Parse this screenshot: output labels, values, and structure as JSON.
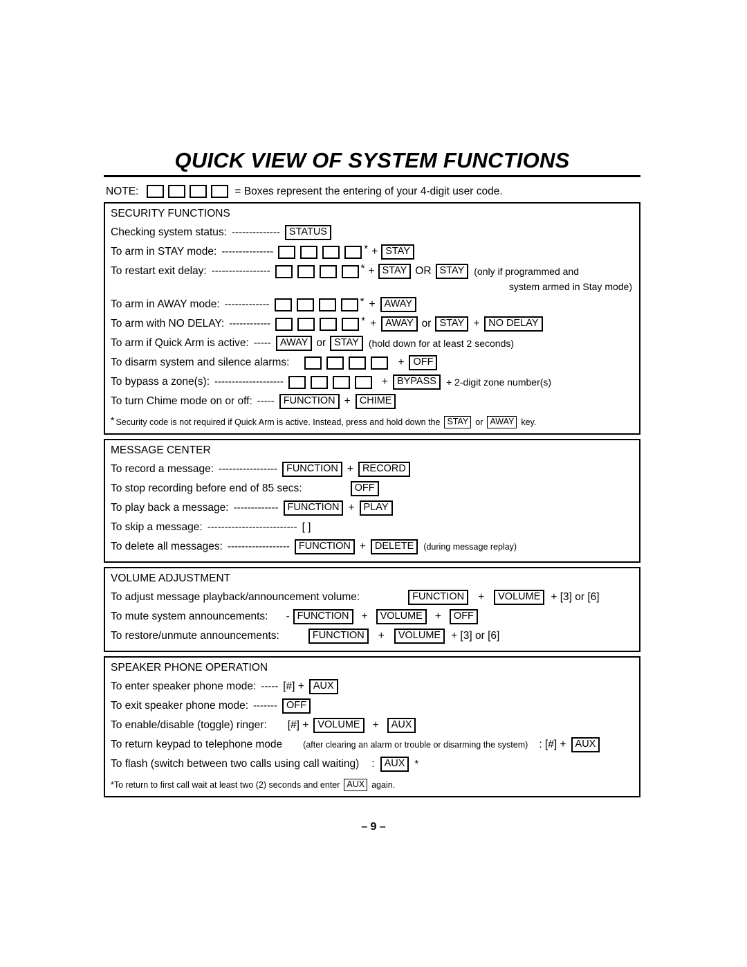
{
  "document": {
    "title": "QUICK VIEW OF SYSTEM FUNCTIONS",
    "page_number": "– 9 –"
  },
  "note": {
    "label": "NOTE:",
    "box_count": 4,
    "text": "= Boxes represent the entering of your 4-digit user code."
  },
  "sections": [
    {
      "id": "security-functions",
      "title": "SECURITY FUNCTIONS",
      "rows": [
        {
          "label": "Checking system status:",
          "leader": "--------------",
          "keys": [
            "STATUS"
          ]
        },
        {
          "label": "To arm in STAY mode:",
          "leader": "---------------",
          "star": "*",
          "plus": "+",
          "keys": [
            "STAY"
          ]
        },
        {
          "label": "To restart exit delay:",
          "leader": "-----------------",
          "star": "*",
          "plus": "+",
          "keys": [
            "STAY",
            "STAY"
          ],
          "conj": "OR",
          "note": "(only if programmed and",
          "note2": "system armed in Stay mode)"
        },
        {
          "label": "To arm in AWAY mode:",
          "leader": "-------------",
          "star": "*",
          "plus": "+",
          "keys": [
            "AWAY"
          ]
        },
        {
          "label": "To arm with NO DELAY:",
          "leader": "------------",
          "star": "*",
          "plus": "+",
          "keys": [
            "AWAY",
            "STAY",
            "NO DELAY"
          ],
          "conj": "or",
          "plus2": "+"
        },
        {
          "label": "To arm if Quick Arm is active:",
          "leader": "-----",
          "keys": [
            "AWAY",
            "STAY"
          ],
          "conj": "or",
          "note": "(hold down for at least 2 seconds)"
        },
        {
          "label": "To disarm system and silence alarms:",
          "plus": "+",
          "keys": [
            "OFF"
          ]
        },
        {
          "label": "To bypass a zone(s):",
          "leader": "--------------------",
          "plus": "+",
          "keys": [
            "BYPASS"
          ],
          "trailing": "+ 2-digit zone number(s)"
        },
        {
          "label": "To turn Chime mode on or off:",
          "leader": "-----",
          "plus": "+",
          "keys": [
            "FUNCTION",
            "CHIME"
          ]
        }
      ],
      "footnote": {
        "star": "*",
        "text_before": "Security code is not required if Quick Arm is active. Instead, press and hold down the",
        "key1": "STAY",
        "conj": "or",
        "key2": "AWAY",
        "text_after": "key."
      }
    },
    {
      "id": "message-center",
      "title": "MESSAGE CENTER",
      "rows": [
        {
          "label": "To record a message:",
          "leader": "-----------------",
          "plus": "+",
          "keys": [
            "FUNCTION",
            "RECORD"
          ]
        },
        {
          "label": "To stop recording before end of 85 secs:",
          "keys": [
            "OFF"
          ]
        },
        {
          "label": "To play back a message:",
          "leader": "-------------",
          "plus": "+",
          "keys": [
            "FUNCTION",
            "PLAY"
          ]
        },
        {
          "label": "To skip a message:",
          "leader": "--------------------------",
          "plain": "[  ]"
        },
        {
          "label": "To delete all messages:",
          "leader": "------------------",
          "plus": "+",
          "keys": [
            "FUNCTION",
            "DELETE"
          ],
          "note_small": "(during message replay)"
        }
      ]
    },
    {
      "id": "volume-adjustment",
      "title": "VOLUME ADJUSTMENT",
      "rows": [
        {
          "label": "To adjust message playback/announcement volume:",
          "plus": "+",
          "keys": [
            "FUNCTION",
            "VOLUME"
          ],
          "trailing": "+ [3]  or [6]"
        },
        {
          "label": "To mute system announcements:",
          "prefix": "-",
          "plus": "+",
          "keys": [
            "FUNCTION",
            "VOLUME",
            "OFF"
          ]
        },
        {
          "label": "To restore/unmute announcements:",
          "plus": "+",
          "keys": [
            "FUNCTION",
            "VOLUME"
          ],
          "trailing": "+ [3]  or [6]"
        }
      ]
    },
    {
      "id": "speaker-phone-operation",
      "title": "SPEAKER PHONE OPERATION",
      "rows": [
        {
          "label": "To enter speaker phone mode:",
          "leader": "-----",
          "prefix": "[#] +",
          "keys": [
            "AUX"
          ]
        },
        {
          "label": "To exit speaker phone mode:",
          "leader": "-------",
          "keys": [
            "OFF"
          ]
        },
        {
          "label": "To enable/disable (toggle) ringer:",
          "prefix": "[#] +",
          "plus": "+",
          "keys": [
            "VOLUME",
            "AUX"
          ]
        },
        {
          "label": "To return keypad to telephone mode",
          "note_small": "(after clearing an alarm or trouble or disarming the system)",
          "prefix": ":  [#] +",
          "keys": [
            "AUX"
          ]
        },
        {
          "label": "To flash   (switch between two calls using call waiting)",
          "prefix": ":",
          "keys": [
            "AUX"
          ],
          "star_after": "*"
        }
      ],
      "footnote": {
        "text_before": "*To return to first call wait at least two (2) seconds and enter",
        "key1": "AUX",
        "text_after": "again."
      }
    }
  ]
}
